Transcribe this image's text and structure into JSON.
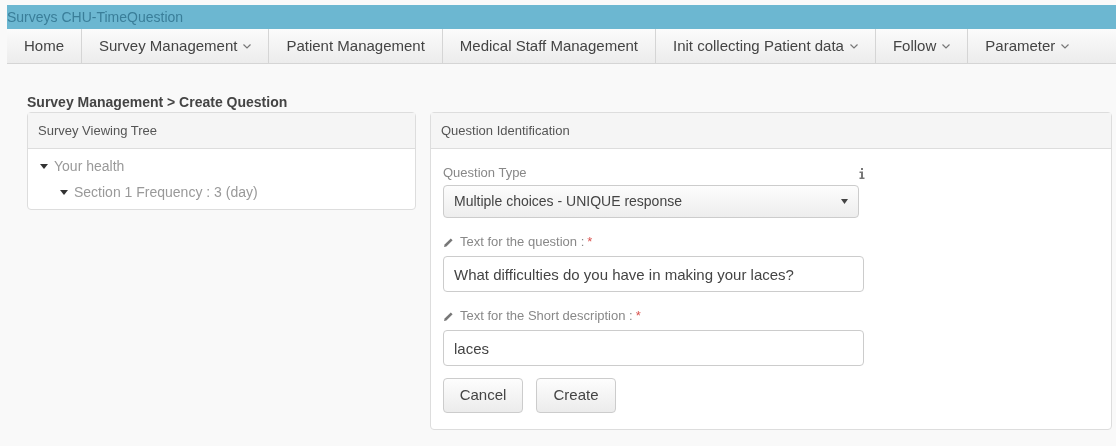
{
  "app_title": "Surveys CHU-TimeQuestion",
  "nav": [
    {
      "label": "Home",
      "dropdown": false
    },
    {
      "label": "Survey Management",
      "dropdown": true
    },
    {
      "label": "Patient Management",
      "dropdown": false
    },
    {
      "label": "Medical Staff Management",
      "dropdown": false
    },
    {
      "label": "Init collecting Patient data",
      "dropdown": true
    },
    {
      "label": "Follow",
      "dropdown": true
    },
    {
      "label": "Parameter",
      "dropdown": true
    }
  ],
  "breadcrumb": "Survey Management > Create Question",
  "tree_panel": {
    "title": "Survey Viewing Tree",
    "items": [
      {
        "label": "Your health",
        "expanded": true,
        "children": [
          {
            "label": "Section 1 Frequency : 3 (day)",
            "expanded": true
          }
        ]
      }
    ]
  },
  "form_panel": {
    "title": "Question Identification",
    "question_type": {
      "label": "Question Type",
      "value": "Multiple choices - UNIQUE response"
    },
    "fields": [
      {
        "label": "Text for the question :",
        "required_mark": "*",
        "value": "What difficulties do you have in making your laces?"
      },
      {
        "label": "Text for the Short description :",
        "required_mark": "*",
        "value": "laces"
      }
    ],
    "buttons": [
      "Cancel",
      "Create"
    ]
  }
}
